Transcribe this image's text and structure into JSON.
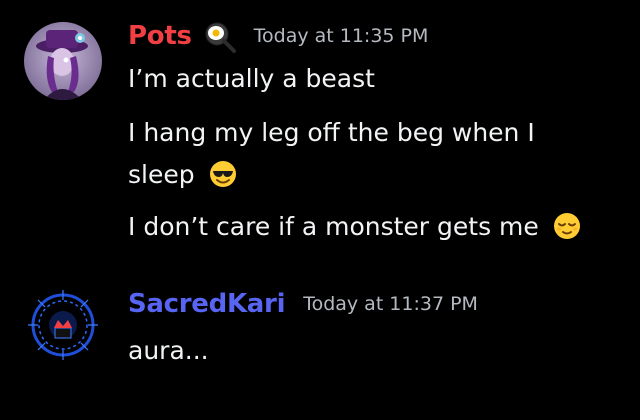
{
  "messages": [
    {
      "author": {
        "name": "Pots",
        "color": "#f23f43",
        "avatar_icon": "avatar-pots",
        "tag_icon": "frying-pan-egg-icon"
      },
      "timestamp": "Today at 11:35 PM",
      "lines": [
        "I’m actually a beast",
        "I hang my leg off the beg when I",
        "sleep",
        "I don’t care if a monster gets me"
      ],
      "emojis": [
        "smiling-face-with-sunglasses-emoji",
        "relieved-face-emoji"
      ]
    },
    {
      "author": {
        "name": "SacredKari",
        "color": "#5865f2",
        "avatar_icon": "avatar-sacredkari"
      },
      "timestamp": "Today at 11:37 PM",
      "lines": [
        "aura..."
      ]
    }
  ]
}
